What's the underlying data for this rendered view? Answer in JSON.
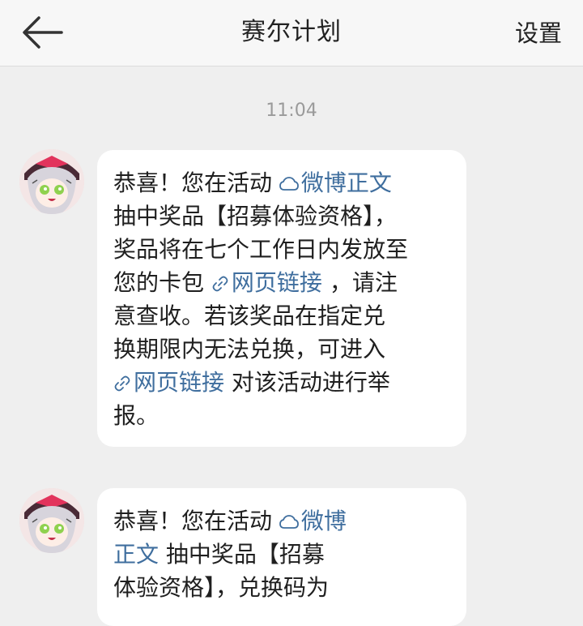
{
  "header": {
    "title": "赛尔计划",
    "settings_label": "设置"
  },
  "timestamp": "11:04",
  "messages": [
    {
      "pre": "恭喜！您在活动 ",
      "link1": "微博正文",
      "line2": "抽中奖品【招募体验资格】，",
      "line3": "奖品将在七个工作日内发放至",
      "line4_pre": "您的卡包 ",
      "link2": "网页链接",
      "line4_post": " ，请注",
      "line5": "意查收。若该奖品在指定兑",
      "line6": "换期限内无法兑换，可进入",
      "link3": "网页链接",
      "line7_post": " 对该活动进行举",
      "line8": "报。"
    },
    {
      "pre": "恭喜！您在活动 ",
      "link1a": "微博",
      "link1b": "正文",
      "line2_post": " 抽中奖品【招募",
      "line3": "体验资格】，兑换码为"
    }
  ]
}
